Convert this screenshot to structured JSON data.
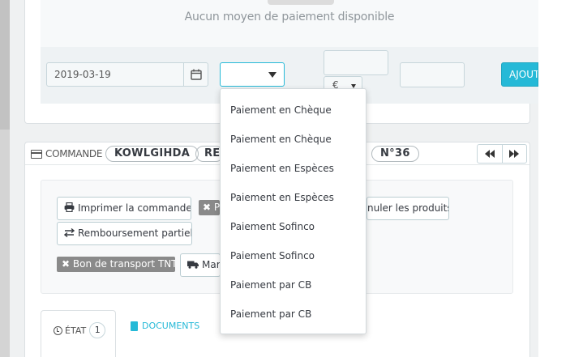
{
  "payment": {
    "no_method_text": "Aucun moyen de paiement disponible",
    "date_value": "2019-03-19",
    "method_value": "",
    "amount_value": "",
    "currency_value": "€",
    "invoice_value": "",
    "add_label": "AJOUTER",
    "method_options": [
      "Paiement en Chèque",
      "Paiement en Chèque",
      "Paiement en Espèces",
      "Paiement en Espèces",
      "Paiement Sofinco",
      "Paiement Sofinco",
      "Paiement par CB",
      "Paiement par CB"
    ]
  },
  "order": {
    "section_label": "COMMANDE",
    "reference": "KOWLGIHDA",
    "reference2_partial": "RE",
    "number": "N°36",
    "prev_icon": "fast-backward-icon",
    "next_icon": "fast-forward-icon",
    "actions": {
      "print_label": "Imprimer la commande",
      "cancel_products_partial": "nuler les produits",
      "partial_refund_label": "Remboursement partiel",
      "tag1_partial": "P",
      "tnt_label": "Bon de transport TNT",
      "manual_partial": "Mar"
    },
    "tabs": {
      "status_label": "ÉTAT",
      "status_count": "1",
      "documents_label": "DOCUMENTS"
    }
  },
  "colors": {
    "accent": "#25b9d7",
    "tag_gray": "#8a8a8a",
    "background": "#eff1f2"
  }
}
